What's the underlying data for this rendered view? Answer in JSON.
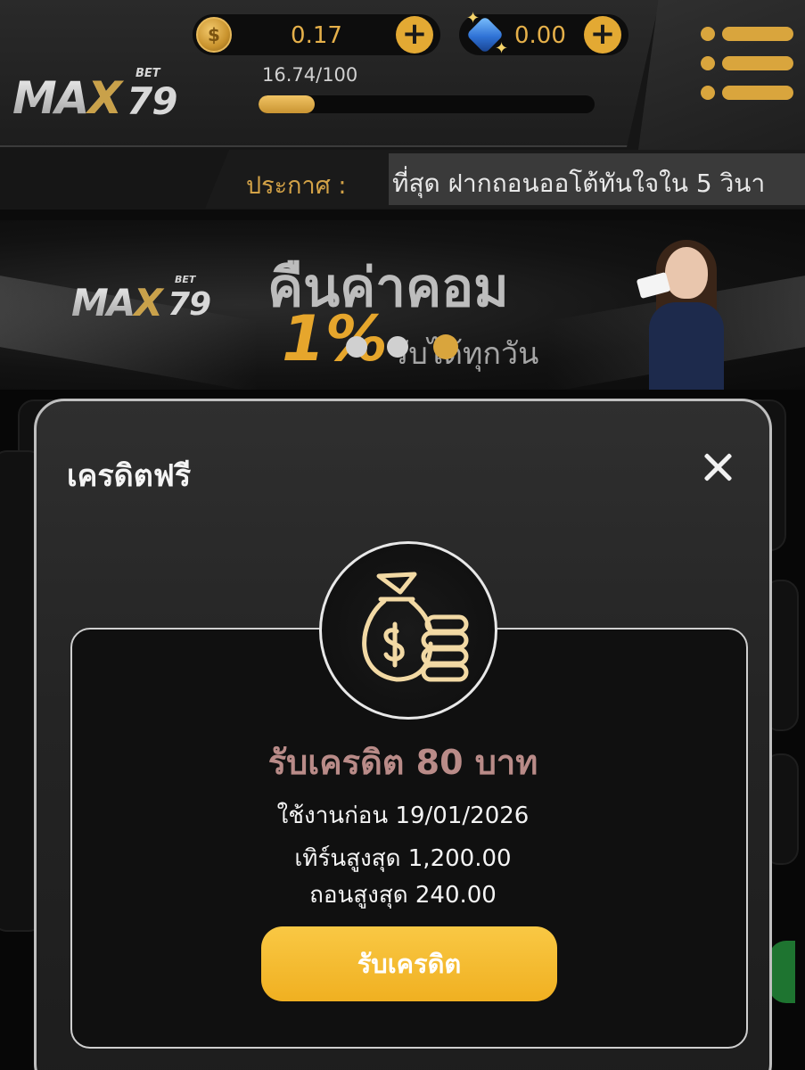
{
  "header": {
    "logo_text": "MAX",
    "logo_x": "X",
    "logo_num": "79",
    "logo_sup": "BET",
    "balance": "0.17",
    "gems": "0.00",
    "progress_text": "16.74/100",
    "progress_value": 16.74,
    "progress_max": 100
  },
  "announcement": {
    "label": "ประกาศ :",
    "text": "ที่สุด ฝากถอนออโต้ทันใจใน 5 วินา"
  },
  "banner": {
    "title": "คืนค่าคอม",
    "percent": "1%",
    "subtitle": "รับได้ทุกวัน"
  },
  "modal": {
    "title": "เครดิตฟรี",
    "reward_title": "รับเครดิต 80 บาท",
    "use_before": "ใช้งานก่อน 19/01/2026",
    "max_turn": "เทิร์นสูงสุด 1,200.00",
    "max_withdraw": "ถอนสูงสุด 240.00",
    "claim_label": "รับเครดิต"
  },
  "colors": {
    "accent_gold": "#e3a933",
    "claim_button": "#f4b82a",
    "reward_title": "#b98b88"
  },
  "icons": [
    "coin-icon",
    "plus-icon",
    "gem-icon",
    "menu-icon",
    "close-icon",
    "money-bag-icon"
  ]
}
